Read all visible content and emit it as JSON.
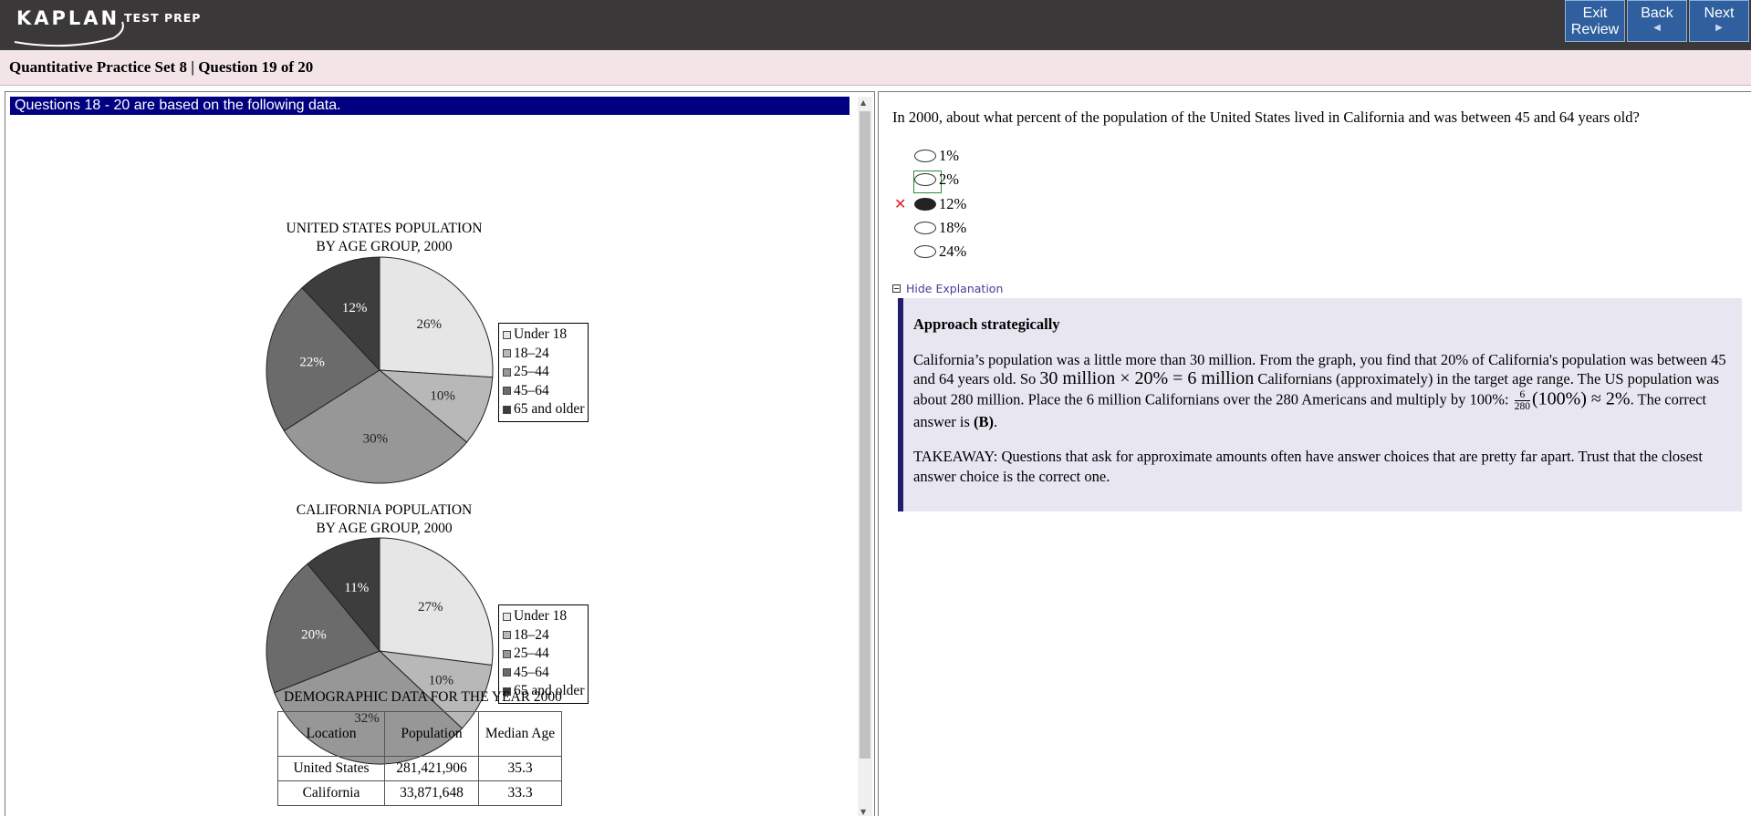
{
  "header": {
    "logo_text": "KAPLAN",
    "logo_subtext": "TEST PREP",
    "exit_review_line1": "Exit",
    "exit_review_line2": "Review",
    "back_label": "Back",
    "next_label": "Next",
    "back_arrow": "◀",
    "next_arrow": "▶",
    "bg_color": "#3a3838",
    "button_color": "#2f5f9e"
  },
  "titlebar": {
    "text": "Quantitative Practice Set 8 | Question  19 of 20",
    "bg_color": "#f3e4e8"
  },
  "left_pane": {
    "header": "Questions 18 - 20 are based on the following data.",
    "header_color": "#000080",
    "chart_data": [
      {
        "type": "pie",
        "title_line1": "UNITED STATES POPULATION",
        "title_line2": "BY AGE GROUP, 2000",
        "categories": [
          "Under 18",
          "18–24",
          "25–44",
          "45–64",
          "65 and older"
        ],
        "values": [
          26,
          10,
          30,
          22,
          12
        ],
        "labels": [
          "26%",
          "10%",
          "30%",
          "22%",
          "12%"
        ],
        "colors": [
          "#e6e6e6",
          "#b8b8b8",
          "#979797",
          "#6b6b6b",
          "#3d3d3d"
        ],
        "legend_position": "right"
      },
      {
        "type": "pie",
        "title_line1": "CALIFORNIA POPULATION",
        "title_line2": "BY AGE GROUP, 2000",
        "categories": [
          "Under 18",
          "18–24",
          "25–44",
          "45–64",
          "65 and older"
        ],
        "values": [
          27,
          10,
          32,
          20,
          11
        ],
        "labels": [
          "27%",
          "10%",
          "32%",
          "20%",
          "11%"
        ],
        "colors": [
          "#e6e6e6",
          "#b8b8b8",
          "#979797",
          "#6b6b6b",
          "#3d3d3d"
        ],
        "legend_position": "right"
      },
      {
        "type": "table",
        "title": "DEMOGRAPHIC DATA FOR THE YEAR 2000",
        "columns": [
          "Location",
          "Population",
          "Median Age"
        ],
        "rows": [
          [
            "United States",
            "281,421,906",
            "35.3"
          ],
          [
            "California",
            "33,871,648",
            "33.3"
          ]
        ]
      }
    ]
  },
  "question": {
    "text": "In 2000, about what percent of the population of the United States lived in California and was between 45 and 64 years old?",
    "choices": [
      "1%",
      "2%",
      "12%",
      "18%",
      "24%"
    ],
    "selected_index": 2,
    "correct_index": 1,
    "wrong_mark": "✕"
  },
  "explanation": {
    "toggle_label": "Hide Explanation",
    "heading": "Approach strategically",
    "p1_a": "California’s population was a little more than 30 million. From the graph, you find that 20% of California's population was between 45 and 64 years old. So ",
    "math1": "30 million  ×  20%  =  6 million",
    "p1_b": " Californians (approximately) in the target age range. The US population was about 280 million. Place the 6 million Californians over the 280 Americans and multiply by 100%: ",
    "frac_num": "6",
    "frac_den": "280",
    "math2": "(100%) ≈ 2%",
    "p1_c": ". The correct answer is ",
    "answer": "(B)",
    "p1_d": ".",
    "takeaway": "TAKEAWAY: Questions that ask for approximate amounts often have answer choices that are pretty far apart. Trust that the closest answer choice is the correct one.",
    "bar_color": "#231d6e",
    "bg_color": "#e8e6f0"
  }
}
